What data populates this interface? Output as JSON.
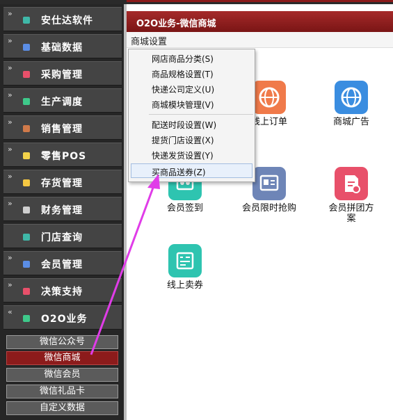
{
  "sidebar": {
    "items": [
      {
        "label": "安仕达软件",
        "color": "#3fb8a8"
      },
      {
        "label": "基础数据",
        "color": "#5b8ee6"
      },
      {
        "label": "采购管理",
        "color": "#e8506a"
      },
      {
        "label": "生产调度",
        "color": "#3ec98a"
      },
      {
        "label": "销售管理",
        "color": "#d07a4a"
      },
      {
        "label": "零售POS",
        "color": "#f2d24a"
      },
      {
        "label": "存货管理",
        "color": "#f5c842"
      },
      {
        "label": "财务管理",
        "color": "#cfcfcf"
      },
      {
        "label": "门店查询",
        "color": "#3fb8a8"
      },
      {
        "label": "会员管理",
        "color": "#5b8ee6"
      },
      {
        "label": "决策支持",
        "color": "#e8506a"
      },
      {
        "label": "O2O业务",
        "color": "#3ec98a"
      }
    ],
    "subitems": [
      "微信公众号",
      "微信商城",
      "微信会员",
      "微信礼品卡",
      "自定义数据"
    ],
    "active_subitem": "微信商城"
  },
  "window": {
    "title": "O2O业务-微信商城"
  },
  "menubar": {
    "label": "商城设置"
  },
  "dropdown": {
    "items": [
      "网店商品分类(S)",
      "商品规格设置(T)",
      "快递公司定义(U)",
      "商城模块管理(V)",
      "配送时段设置(W)",
      "提货门店设置(X)",
      "快递发货设置(Y)",
      "买商品送券(Z)"
    ],
    "highlighted": "买商品送券(Z)"
  },
  "apps": [
    {
      "label": "线上订单",
      "color": "#f07a4a",
      "icon": "globe-icon"
    },
    {
      "label": "商城广告",
      "color": "#3a8de0",
      "icon": "globe-icon"
    },
    {
      "label": "会员签到",
      "color": "#2ec4b0",
      "icon": "sign-in-icon"
    },
    {
      "label": "会员限时抢购",
      "color": "#6e85b7",
      "icon": "flash-sale-icon"
    },
    {
      "label": "会员拼团方案",
      "color": "#e8506a",
      "icon": "group-buy-icon"
    },
    {
      "label": "线上卖券",
      "color": "#2ec4b0",
      "icon": "coupon-icon"
    }
  ],
  "colors": {
    "accent": "#8c1b1b",
    "arrow": "#e03ce8"
  }
}
